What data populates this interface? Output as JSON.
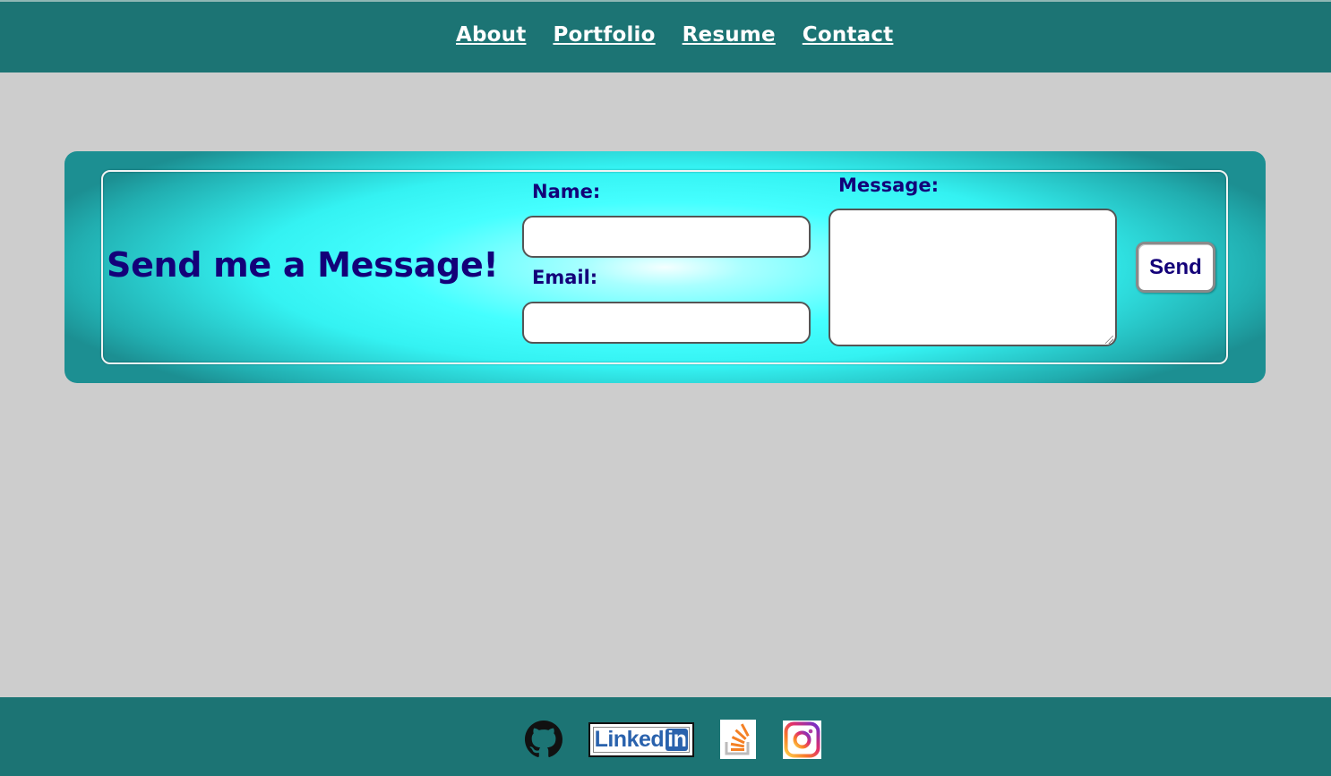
{
  "nav": {
    "items": [
      {
        "label": "About"
      },
      {
        "label": "Portfolio"
      },
      {
        "label": "Resume"
      },
      {
        "label": "Contact"
      }
    ]
  },
  "contact": {
    "headline": "Send me a Message!",
    "name_label": "Name:",
    "name_value": "",
    "email_label": "Email:",
    "email_value": "",
    "message_label": "Message:",
    "message_value": "",
    "send_label": "Send"
  },
  "footer": {
    "linkedin_text_a": "Linked",
    "linkedin_text_b": "in",
    "icons": [
      "github-icon",
      "linkedin-icon",
      "stackoverflow-icon",
      "instagram-icon"
    ]
  },
  "colors": {
    "bar": "#1c7474",
    "page_background": "#cdcdcd",
    "text_navy": "#130079",
    "accent_cyan": "#45ffff"
  }
}
